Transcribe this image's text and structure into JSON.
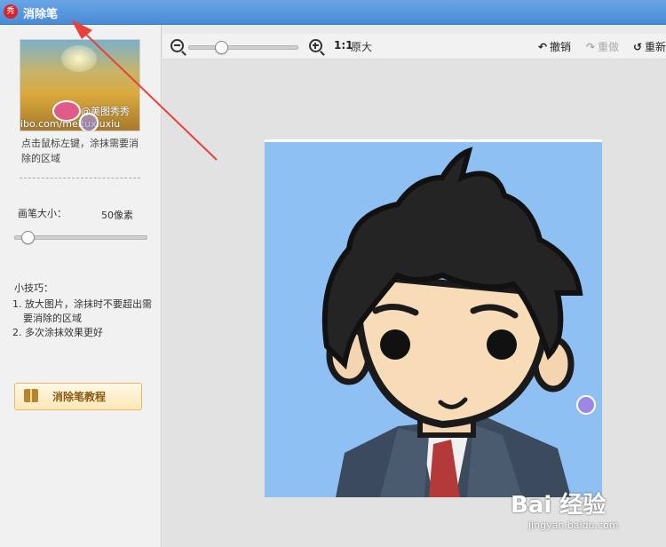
{
  "window": {
    "title": "消除笔",
    "app_icon_glyph": "秀"
  },
  "sidebar": {
    "thumbnail": {
      "watermark_name": "@美图秀秀",
      "watermark_url": "ibo.com/meituxiuxiu"
    },
    "hint": "点击鼠标左键，涂抹需要消除的区域",
    "brush_size": {
      "label": "画笔大小：",
      "value": "50像素",
      "level": 0.1
    },
    "tips_title": "小技巧：",
    "tips": [
      "1. 放大图片，涂抹时不要超出需要消除的区域",
      "2. 多次涂抹效果更好"
    ],
    "tutorial_button": "消除笔教程"
  },
  "toolbar": {
    "ratio_label": "1:1",
    "original_label": "原大",
    "undo_label": "撤销",
    "redo_label": "重做",
    "reset_label": "重新",
    "zoom_level": 0.3
  },
  "watermark": {
    "brand": "Bai 经验",
    "url": "jingyan.baidu.com"
  },
  "colors": {
    "titlebar": "#5b97dc",
    "photo_bg": "#8fc0f4",
    "accent_arrow": "#e8413a"
  }
}
